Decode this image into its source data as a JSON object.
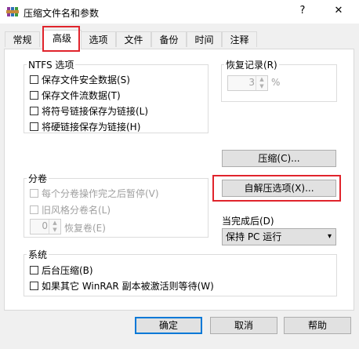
{
  "window": {
    "title": "压缩文件名和参数",
    "help_glyph": "?",
    "close_glyph": "✕"
  },
  "tabs": [
    {
      "label": "常规"
    },
    {
      "label": "高级"
    },
    {
      "label": "选项"
    },
    {
      "label": "文件"
    },
    {
      "label": "备份"
    },
    {
      "label": "时间"
    },
    {
      "label": "注释"
    }
  ],
  "active_tab": "高级",
  "ntfs": {
    "title": "NTFS 选项",
    "options": [
      {
        "label": "保存文件安全数据(S)",
        "checked": false
      },
      {
        "label": "保存文件流数据(T)",
        "checked": false
      },
      {
        "label": "将符号链接保存为链接(L)",
        "checked": false
      },
      {
        "label": "将硬链接保存为链接(H)",
        "checked": false
      }
    ]
  },
  "recovery": {
    "title": "恢复记录(R)",
    "value": "3",
    "unit": "%"
  },
  "split": {
    "title": "分卷",
    "pause_label": "每个分卷操作完之后暂停(V)",
    "oldstyle_label": "旧风格分卷名(L)",
    "recovery_volumes_value": "0",
    "recovery_volumes_label": "恢复卷(E)"
  },
  "buttons": {
    "compress": "压缩(C)...",
    "sfx": "自解压选项(X)..."
  },
  "after": {
    "label": "当完成后(D)",
    "selected": "保持 PC 运行"
  },
  "system": {
    "title": "系统",
    "options": [
      {
        "label": "后台压缩(B)",
        "checked": false
      },
      {
        "label": "如果其它 WinRAR 副本被激活则等待(W)",
        "checked": false
      }
    ]
  },
  "footer": {
    "ok": "确定",
    "cancel": "取消",
    "help": "帮助"
  },
  "colors": {
    "highlight": "#e0242c",
    "accent": "#0078d7"
  }
}
